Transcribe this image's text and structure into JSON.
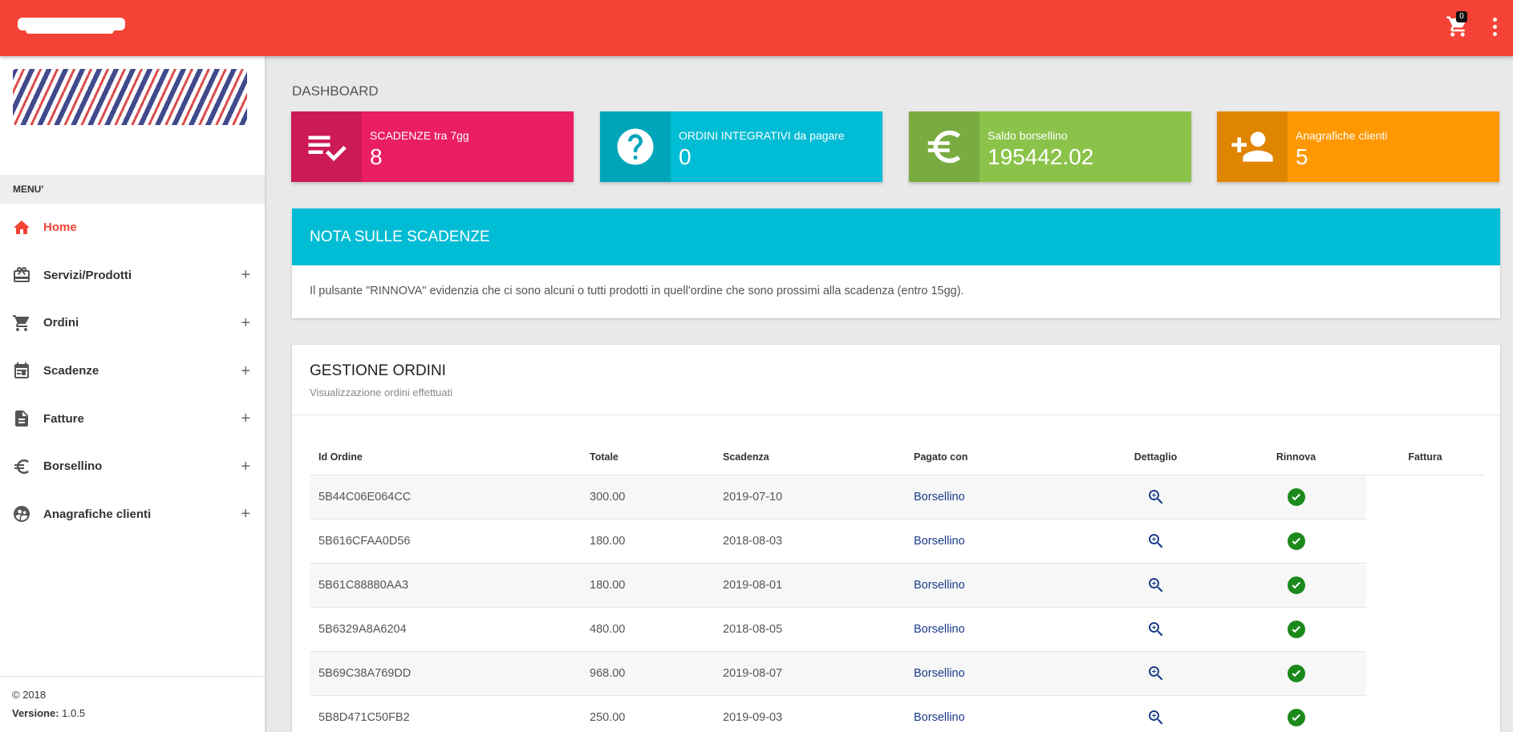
{
  "header": {
    "cart_count": "0",
    "accent": "#f44336"
  },
  "sidebar": {
    "menu_header": "MENU'",
    "items": [
      {
        "label": "Home",
        "icon": "home-icon",
        "active": true
      },
      {
        "label": "Servizi/Prodotti",
        "icon": "gift-card-icon",
        "expandable": "+"
      },
      {
        "label": "Ordini",
        "icon": "cart-icon",
        "expandable": "+"
      },
      {
        "label": "Scadenze",
        "icon": "calendar-icon",
        "expandable": "+"
      },
      {
        "label": "Fatture",
        "icon": "document-icon",
        "expandable": "+"
      },
      {
        "label": "Borsellino",
        "icon": "euro-icon",
        "expandable": "+"
      },
      {
        "label": "Anagrafiche clienti",
        "icon": "people-icon",
        "expandable": "+"
      }
    ],
    "footer": {
      "copyright": "© 2018",
      "version_label": "Versione:",
      "version_value": "1.0.5"
    }
  },
  "main": {
    "page_title": "DASHBOARD",
    "info_boxes": [
      {
        "text": "SCADENZE tra 7gg",
        "number": "8",
        "icon": "playlist-check-icon",
        "color": "#e91e63"
      },
      {
        "text": "ORDINI INTEGRATIVI da pagare",
        "number": "0",
        "icon": "help-circle-icon",
        "color": "#00bcd4"
      },
      {
        "text": "Saldo borsellino",
        "number": "195442.02",
        "icon": "euro-icon",
        "color": "#8bc34a"
      },
      {
        "text": "Anagrafiche clienti",
        "number": "5",
        "icon": "person-add-icon",
        "color": "#ff9800"
      }
    ],
    "note": {
      "title": "NOTA SULLE SCADENZE",
      "body": "Il pulsante \"RINNOVA\" evidenzia che ci sono alcuni o tutti prodotti in quell'ordine che sono prossimi alla scadenza (entro 15gg)."
    },
    "orders": {
      "title": "GESTIONE ORDINI",
      "subtitle": "Visualizzazione ordini effettuati",
      "columns": [
        "Id Ordine",
        "Totale",
        "Scadenza",
        "Pagato con",
        "Dettaglio",
        "Rinnova",
        "Fattura"
      ],
      "rows": [
        {
          "id": "5B44C06E064CC",
          "totale": "300.00",
          "scadenza": "2019-07-10",
          "pagato": "Borsellino"
        },
        {
          "id": "5B616CFAA0D56",
          "totale": "180.00",
          "scadenza": "2018-08-03",
          "pagato": "Borsellino"
        },
        {
          "id": "5B61C88880AA3",
          "totale": "180.00",
          "scadenza": "2019-08-01",
          "pagato": "Borsellino"
        },
        {
          "id": "5B6329A8A6204",
          "totale": "480.00",
          "scadenza": "2018-08-05",
          "pagato": "Borsellino"
        },
        {
          "id": "5B69C38A769DD",
          "totale": "968.00",
          "scadenza": "2019-08-07",
          "pagato": "Borsellino"
        },
        {
          "id": "5B8D471C50FB2",
          "totale": "250.00",
          "scadenza": "2019-09-03",
          "pagato": "Borsellino"
        }
      ]
    }
  }
}
